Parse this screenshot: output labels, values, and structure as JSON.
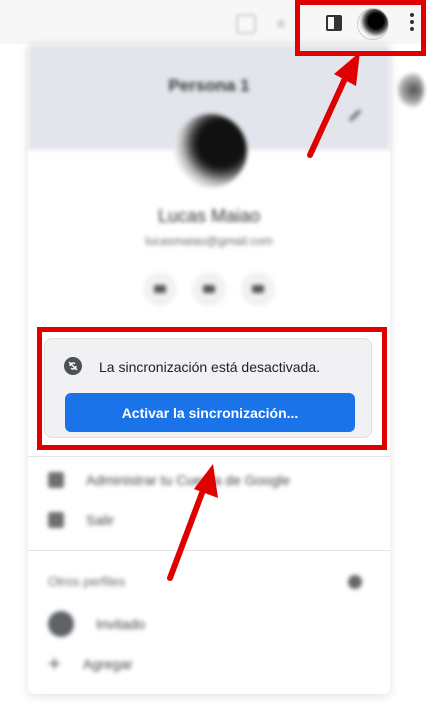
{
  "panel": {
    "profile_title": "Persona 1",
    "user_name": "Lucas Maiao",
    "user_email": "lucasmaiao@gmail.com"
  },
  "sync": {
    "status_text": "La sincronización está desactivada.",
    "button_label": "Activar la sincronización..."
  },
  "menu": {
    "manage_account": "Administrar tu Cuenta de Google",
    "sign_out": "Salir"
  },
  "other_profiles": {
    "section_label": "Otros perfiles",
    "guest": "Invitado",
    "add": "Agregar"
  },
  "colors": {
    "accent_blue": "#1a73e8",
    "annotation_red": "#e00000"
  },
  "icons": [
    "sidepanel-icon",
    "profile-avatar-icon",
    "more-vert-icon",
    "sync-off-icon"
  ]
}
